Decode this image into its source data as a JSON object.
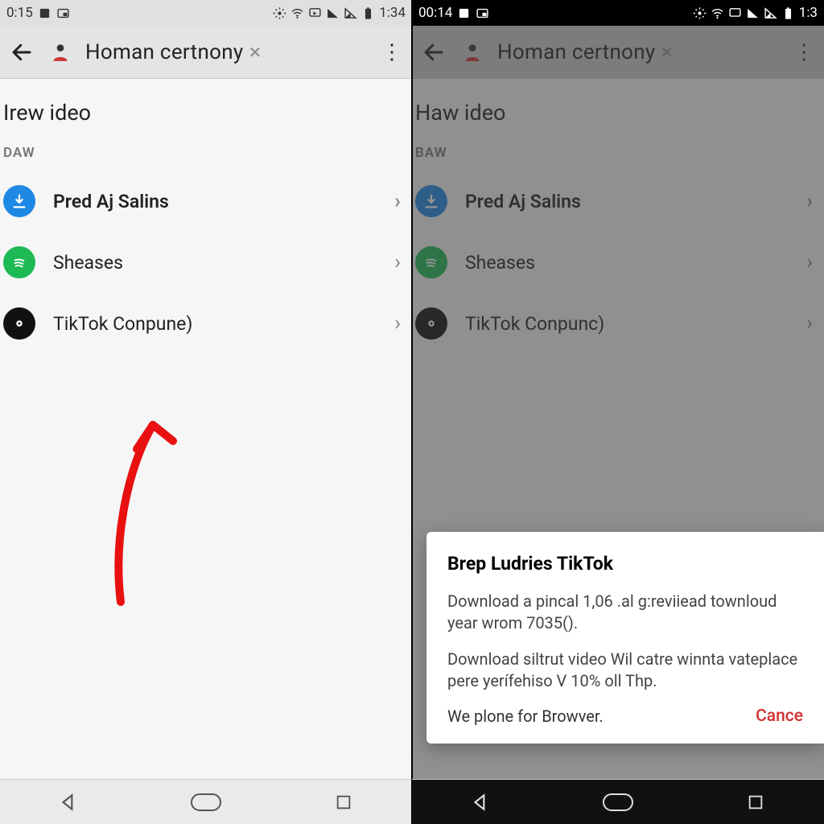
{
  "phone_a": {
    "status": {
      "time": "0:15",
      "right_time": "1:34"
    },
    "header": {
      "title": "Homan certnony"
    },
    "section_title": "Irew ideo",
    "section_sub": "DAW",
    "rows": [
      {
        "label": "Pred Aj Salins"
      },
      {
        "label": "Sheases"
      },
      {
        "label": "TikTok Conpune)"
      }
    ]
  },
  "phone_b": {
    "status": {
      "time": "00:14",
      "right_time": "1:3"
    },
    "header": {
      "title": "Homan certnony"
    },
    "section_title": "Haw ideo",
    "section_sub": "BAW",
    "rows": [
      {
        "label": "Pred Aj Salins"
      },
      {
        "label": "Sheases"
      },
      {
        "label": "TikTok Conpunc)"
      }
    ],
    "dialog": {
      "title": "Brep Ludries TikTok",
      "p1": "Download a pincal 1,06 .al g:reviiead townloud year wrom 7035().",
      "p2": "Download siltrut video Wil catre winnta vateplace pere yerífehiso V 10% oll Thp.",
      "left_action": "We plone for Browver.",
      "right_action": "Cance"
    }
  },
  "colors": {
    "accent_blue": "#1e88e5",
    "accent_green": "#1db954",
    "accent_red": "#d32f2f"
  }
}
